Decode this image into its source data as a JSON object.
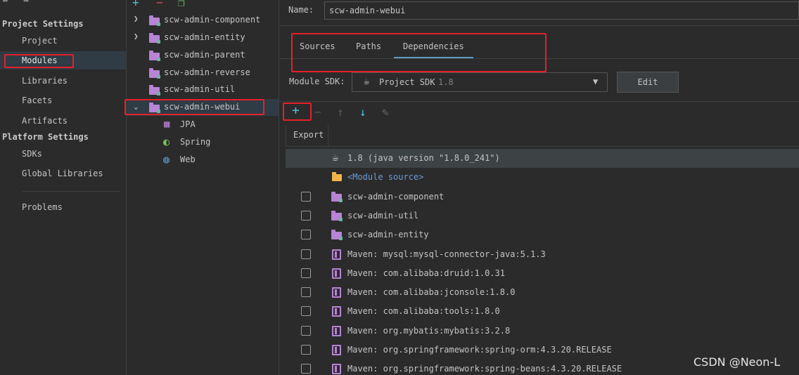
{
  "nav": {
    "back_icon": "arrow-left-icon",
    "forward_icon": "arrow-right-icon",
    "project_settings_heading": "Project Settings",
    "project_items": [
      "Project",
      "Modules",
      "Libraries",
      "Facets",
      "Artifacts"
    ],
    "platform_settings_heading": "Platform Settings",
    "platform_items": [
      "SDKs",
      "Global Libraries"
    ],
    "problems": "Problems",
    "selected": "Modules"
  },
  "tree": {
    "toolbar": [
      "add-icon",
      "remove-icon",
      "copy-icon"
    ],
    "modules": [
      {
        "label": "scw-admin-component",
        "expandable": true
      },
      {
        "label": "scw-admin-entity",
        "expandable": true
      },
      {
        "label": "scw-admin-parent",
        "expandable": false
      },
      {
        "label": "scw-admin-reverse",
        "expandable": false
      },
      {
        "label": "scw-admin-util",
        "expandable": false
      },
      {
        "label": "scw-admin-webui",
        "expandable": true,
        "expanded": true,
        "selected": true
      }
    ],
    "facets": [
      "JPA",
      "Spring",
      "Web"
    ]
  },
  "module": {
    "name_label": "Name:",
    "name_value": "scw-admin-webui",
    "tabs": [
      "Sources",
      "Paths",
      "Dependencies"
    ],
    "active_tab": "Dependencies",
    "sdk_label": "Module SDK:",
    "sdk_value": "Project SDK",
    "sdk_version": "1.8",
    "edit_button": "Edit",
    "export_header": "Export",
    "dependencies": [
      {
        "label": "1.8 (java version \"1.8.0_241\")",
        "type": "jdk",
        "checkbox": false
      },
      {
        "label": "<Module source>",
        "type": "source",
        "checkbox": false
      },
      {
        "label": "scw-admin-component",
        "type": "module",
        "checkbox": true
      },
      {
        "label": "scw-admin-util",
        "type": "module",
        "checkbox": true
      },
      {
        "label": "scw-admin-entity",
        "type": "module",
        "checkbox": true
      },
      {
        "label": "Maven: mysql:mysql-connector-java:5.1.3",
        "type": "maven",
        "checkbox": true
      },
      {
        "label": "Maven: com.alibaba:druid:1.0.31",
        "type": "maven",
        "checkbox": true
      },
      {
        "label": "Maven: com.alibaba:jconsole:1.8.0",
        "type": "maven",
        "checkbox": true
      },
      {
        "label": "Maven: com.alibaba:tools:1.8.0",
        "type": "maven",
        "checkbox": true
      },
      {
        "label": "Maven: org.mybatis:mybatis:3.2.8",
        "type": "maven",
        "checkbox": true
      },
      {
        "label": "Maven: org.springframework:spring-orm:4.3.20.RELEASE",
        "type": "maven",
        "checkbox": true
      },
      {
        "label": "Maven: org.springframework:spring-beans:4.3.20.RELEASE",
        "type": "maven",
        "checkbox": true
      }
    ]
  },
  "watermark": "CSDN @Neon-L",
  "colors": {
    "highlight_box": "#e5202a",
    "accent": "#5d9ebf",
    "add_icon": "#4fc1d6"
  }
}
